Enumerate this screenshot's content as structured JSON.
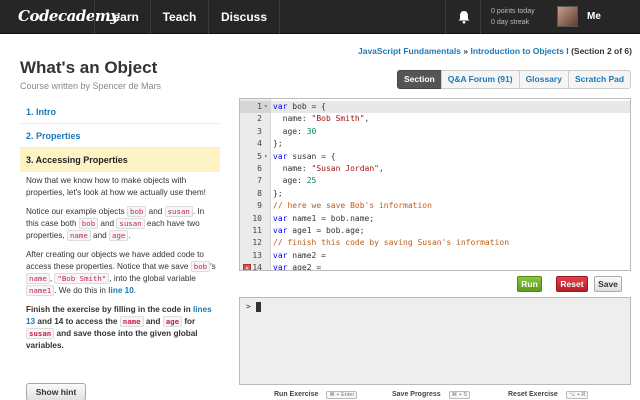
{
  "topbar": {
    "logo": "Codecademy",
    "nav": [
      "Learn",
      "Teach",
      "Discuss"
    ],
    "points_today": "0 points today",
    "day_streak": "0 day streak",
    "user_label": "Me"
  },
  "course": {
    "title": "What's an Object",
    "author": "Course written by Spencer de Mars",
    "sections": [
      "1. Intro",
      "2. Properties",
      "3. Accessing Properties"
    ]
  },
  "breadcrumb": {
    "part1": "JavaScript Fundamentals",
    "sep": "»",
    "part2": "Introduction to Objects I",
    "section_info": "(Section 2 of 6)"
  },
  "tabs": [
    "Section",
    "Q&A Forum (91)",
    "Glossary",
    "Scratch Pad"
  ],
  "lesson": {
    "p1": "Now that we know how to make objects with properties, let's look at how we actually use them!",
    "p2a": "Notice our example objects ",
    "c_bob": "bob",
    "and": " and ",
    "c_susan": "susan",
    "p2b": ". In this case both ",
    "p2c": " each have two properties, ",
    "c_name": "name",
    "c_age": "age",
    "dot": ".",
    "p3a": "After creating our objects we have added code to access these properties. Notice that we save ",
    "c_bob2": "bob",
    "p3b": "'s ",
    "c_name2": "name",
    "comma": ", ",
    "c_bobsmith": "\"Bob Smith\"",
    "p3c": ", into the global variable ",
    "c_name1": "name1",
    "p3d": ". We do this in ",
    "line10": "line 10",
    "p4a": "Finish the exercise by filling in the code in ",
    "lines13": "lines 13",
    "p4b": " and 14 to access the ",
    "c_name3": "name",
    "c_age3": "age",
    "p4c": " for ",
    "c_susan3": "susan",
    "p4d": " and save those into the given global variables."
  },
  "hint_button": "Show hint",
  "editor": {
    "lines": [
      {
        "n": "1",
        "html": "<span class='kw'>var</span> bob = {"
      },
      {
        "n": "2",
        "html": "  name: <span class='str'>\"Bob Smith\"</span>,"
      },
      {
        "n": "3",
        "html": "  age: <span class='num'>30</span>"
      },
      {
        "n": "4",
        "html": "};"
      },
      {
        "n": "5",
        "html": "<span class='kw'>var</span> susan = {"
      },
      {
        "n": "6",
        "html": "  name: <span class='str'>\"Susan Jordan\"</span>,"
      },
      {
        "n": "7",
        "html": "  age: <span class='num'>25</span>"
      },
      {
        "n": "8",
        "html": "};"
      },
      {
        "n": "9",
        "html": "<span class='cmt'>// here we save Bob's information</span>"
      },
      {
        "n": "10",
        "html": "<span class='kw'>var</span> name1 = bob.name;"
      },
      {
        "n": "11",
        "html": "<span class='kw'>var</span> age1 = bob.age;"
      },
      {
        "n": "12",
        "html": "<span class='cmt'>// finish this code by saving Susan's information</span>"
      },
      {
        "n": "13",
        "html": "<span class='kw'>var</span> name2 ="
      },
      {
        "n": "14",
        "html": "<span class='kw'>var</span> age2 ="
      }
    ]
  },
  "buttons": {
    "run": "Run",
    "reset": "Reset",
    "save": "Save"
  },
  "console": {
    "prompt": ">"
  },
  "shortcuts": {
    "run": "Run Exercise",
    "run_key": "⌘ + Enter",
    "save": "Save Progress",
    "save_key": "⌘ + S",
    "reset": "Reset Exercise",
    "reset_key": "⌥ + R"
  },
  "colors": {
    "run": "#6aa62a",
    "reset": "#c8262e",
    "link": "#1a7ab8",
    "active_section_bg": "#fdf3c4"
  }
}
